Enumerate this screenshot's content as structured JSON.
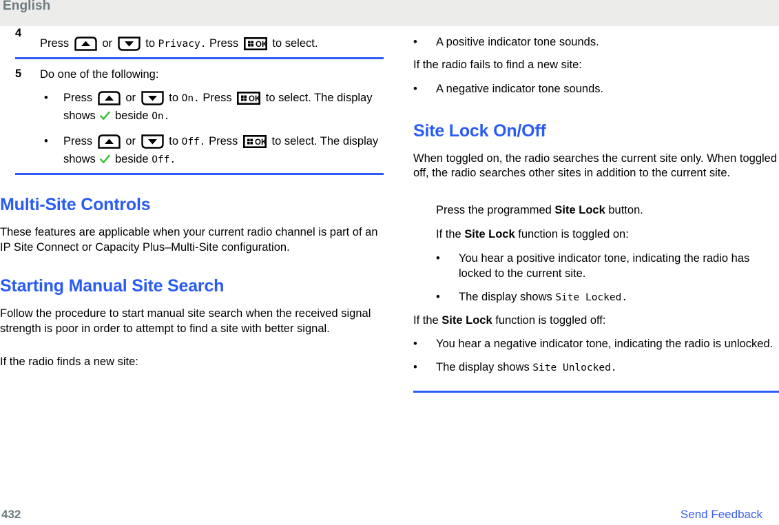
{
  "header": {
    "language": "English"
  },
  "footer": {
    "page_number": "432",
    "send_feedback_label": "Send Feedback"
  },
  "colors": {
    "heading_blue": "#2a5cf5",
    "rule_blue": "#2a5cf5",
    "link_blue": "#3d5cf5",
    "header_band": "#ececeb",
    "header_text": "#6c7b7f",
    "check_green": "#3cc23c"
  },
  "icons": {
    "up_arrow_key": "up-arrow-key-icon",
    "down_arrow_key": "down-arrow-key-icon",
    "menu_ok_key": "menu-ok-key-icon",
    "checkmark": "green-checkmark-icon"
  },
  "left_column": {
    "step4": {
      "number": "4",
      "text_1": "Press",
      "text_or": "or",
      "text_2": "to",
      "menu_item": "Privacy.",
      "text_3": "Press",
      "text_4": "to select."
    },
    "step5": {
      "number": "5",
      "text": "Do one of the following:",
      "bullets": [
        {
          "text_1": "Press",
          "text_or": "or",
          "text_2": "to",
          "value": "On.",
          "text_3": "Press",
          "text_4": "to select. The display shows",
          "text_5": "beside",
          "value_2": "On."
        },
        {
          "text_1": "Press",
          "text_or": "or",
          "text_2": "to",
          "value": "Off.",
          "text_3": "Press",
          "text_4": "to select. The display shows",
          "text_5": "beside",
          "value_2": "Off."
        }
      ]
    },
    "multi_site_controls": {
      "heading": "Multi-Site Controls",
      "body": "These features are applicable when your current radio channel is part of an IP Site Connect or Capacity Plus–Multi-Site configuration."
    },
    "starting_manual_site_search": {
      "heading": "Starting Manual Site Search",
      "body": "Follow the procedure to start manual site search when the received signal strength is poor in order to attempt to find a site with better signal.",
      "lead_in": "If the radio finds a new site:"
    }
  },
  "right_column": {
    "found_site_bullet": "A positive indicator tone sounds.",
    "fail_lead_in": "If the radio fails to find a new site:",
    "fail_bullet": "A negative indicator tone sounds.",
    "site_lock": {
      "heading": "Site Lock On/Off",
      "body": "When toggled on, the radio searches the current site only. When toggled off, the radio searches other sites in addition to the current site.",
      "action_prefix": "Press the programmed",
      "action_bold": "Site Lock",
      "action_suffix": "button.",
      "on_lead_prefix": "If the",
      "on_lead_bold": "Site Lock",
      "on_lead_suffix": "function is toggled on:",
      "on_bullets": [
        {
          "text": "You hear a positive indicator tone, indicating the radio has locked to the current site."
        },
        {
          "text_prefix": "The display shows",
          "mono": "Site Locked."
        }
      ],
      "off_lead_prefix": "If the",
      "off_lead_bold": "Site Lock",
      "off_lead_suffix": "function is toggled off:",
      "off_bullets": [
        {
          "text": "You hear a negative indicator tone, indicating the radio is unlocked."
        },
        {
          "text_prefix": "The display shows",
          "mono": "Site Unlocked."
        }
      ]
    }
  }
}
